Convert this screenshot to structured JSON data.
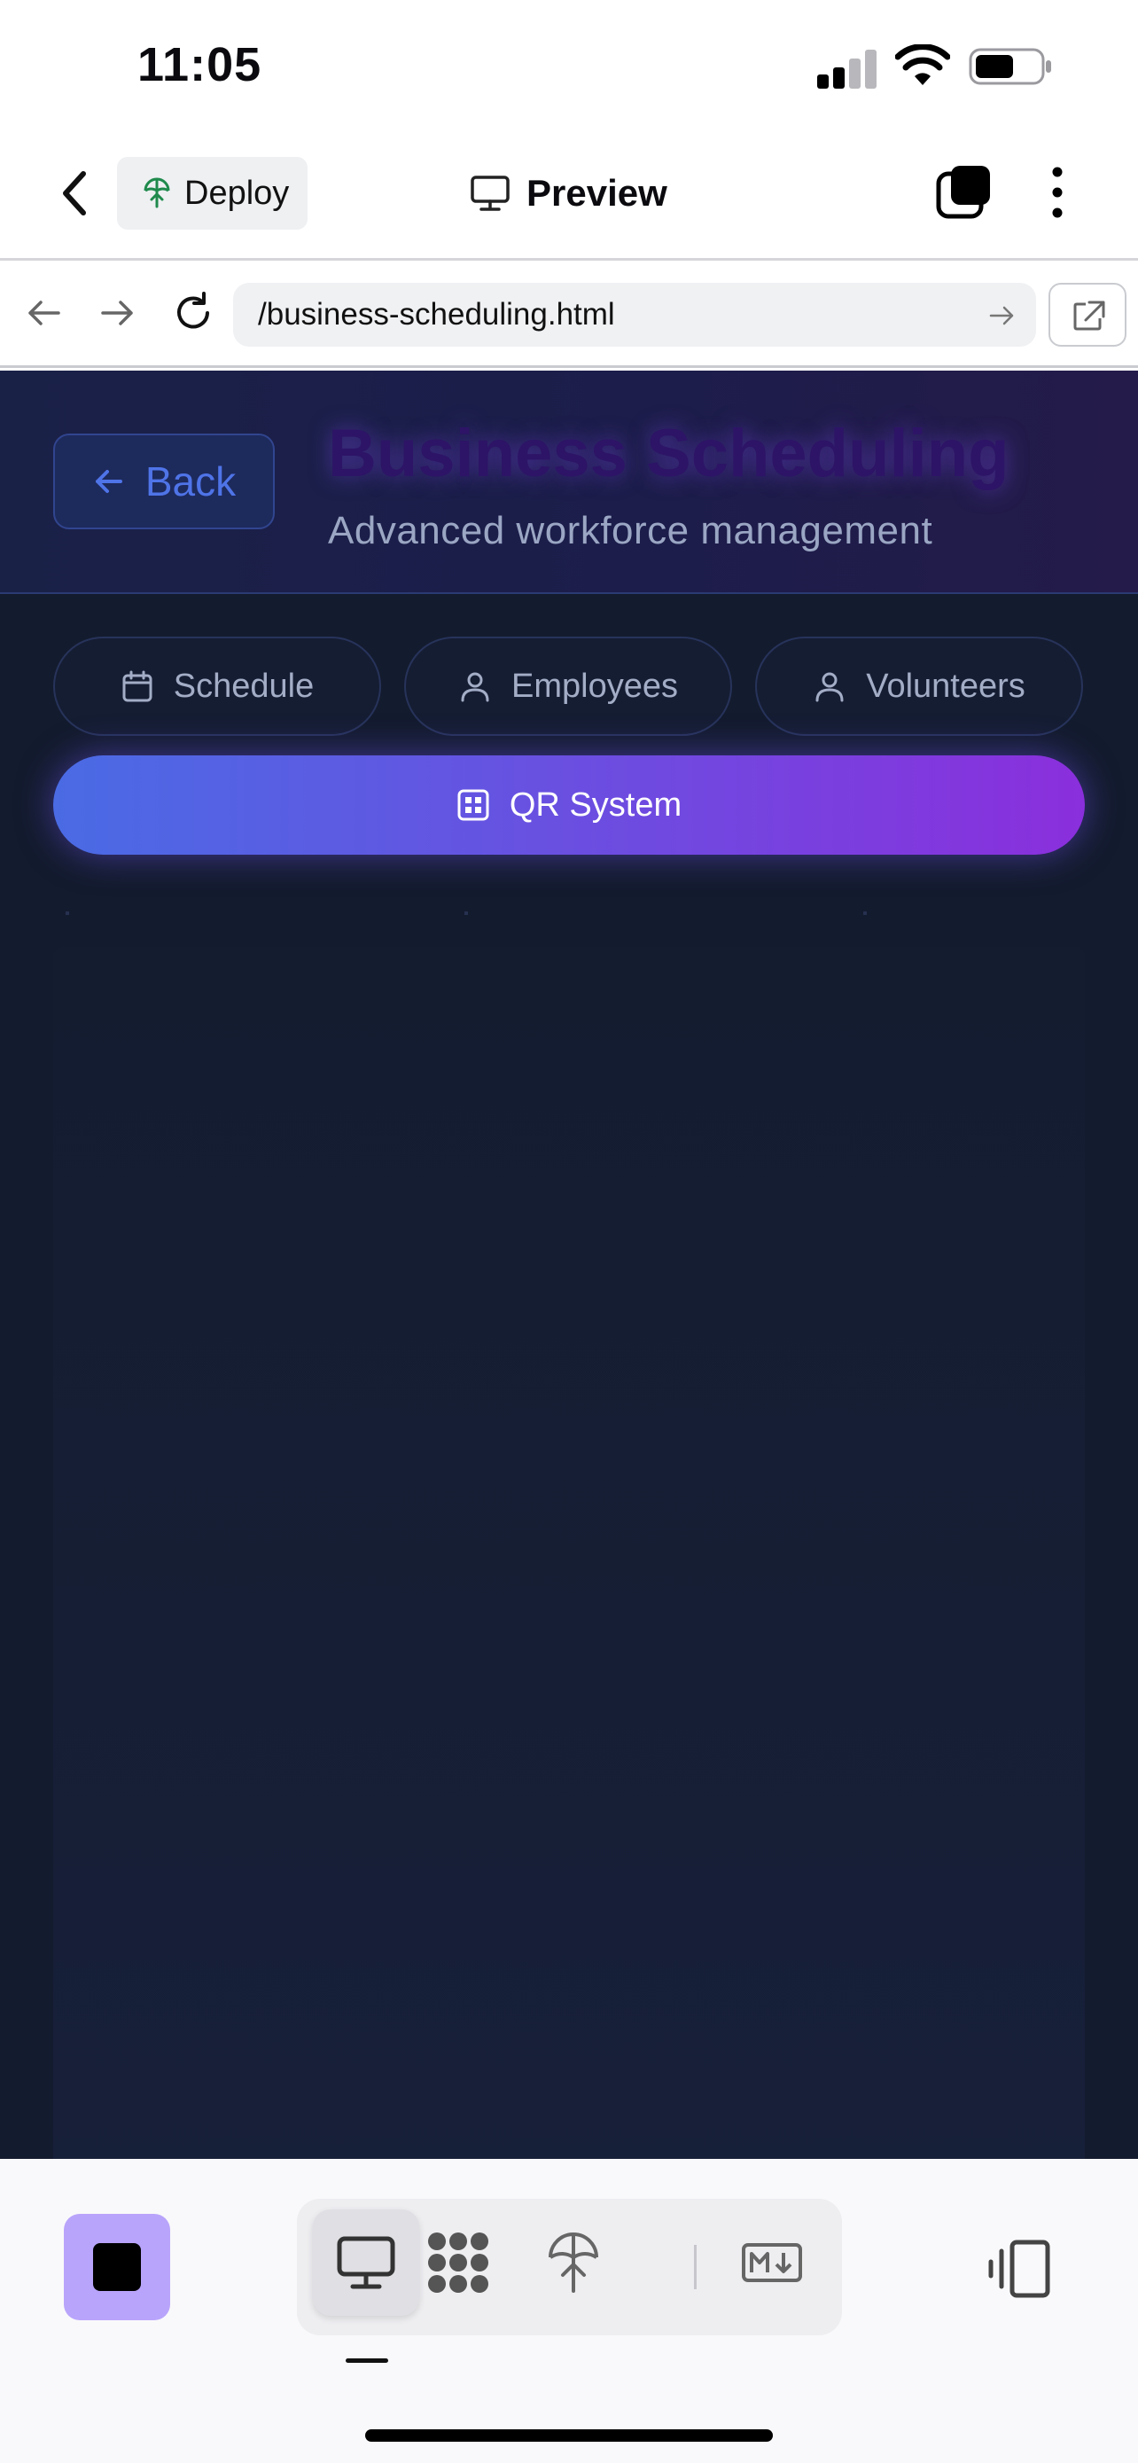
{
  "status_bar": {
    "time": "11:05"
  },
  "app_header": {
    "deploy_label": "Deploy",
    "title": "Preview"
  },
  "url_bar": {
    "url": "/business-scheduling.html"
  },
  "site": {
    "back_label": "Back",
    "title": "Business Scheduling",
    "subtitle": "Advanced workforce management",
    "tabs": [
      {
        "label": "Schedule",
        "icon": "calendar-icon"
      },
      {
        "label": "Employees",
        "icon": "user-icon"
      },
      {
        "label": "Volunteers",
        "icon": "user-icon"
      }
    ],
    "active_tab": {
      "label": "QR System",
      "icon": "qr-grid-icon"
    }
  },
  "colors": {
    "accent_blue": "#4f74e8",
    "gradient_start": "#4a6be4",
    "gradient_end": "#8a2fdc",
    "stop_button": "#b9a4fb",
    "page_background": "#131b2e"
  },
  "toolbar": {
    "items": [
      "monitor-icon",
      "dots-grid-icon",
      "deploy-icon",
      "markdown-icon"
    ],
    "active_index": 0
  }
}
